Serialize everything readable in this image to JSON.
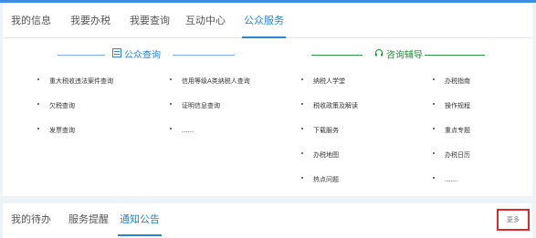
{
  "top_tabs": [
    {
      "label": "我的信息"
    },
    {
      "label": "我要办税"
    },
    {
      "label": "我要查询"
    },
    {
      "label": "互动中心"
    },
    {
      "label": "公众服务"
    }
  ],
  "public_query": {
    "title": "公众查询",
    "icon": "grid-icon",
    "color": "#2a84d6",
    "items": [
      "重大税收违法案件查询",
      "信用等级A类纳税人查询",
      "欠税查询",
      "证明信息查询",
      "发票查询",
      "......"
    ]
  },
  "consult": {
    "title": "咨询辅导",
    "icon": "headset-icon",
    "color": "#1f8f3a",
    "items": [
      "纳税人学堂",
      "办税指南",
      "税收政策及解读",
      "操作规程",
      "下载服务",
      "重点专题",
      "办税地图",
      "办税日历",
      "热点问题",
      "......"
    ]
  },
  "bottom_tabs": [
    {
      "label": "我的待办"
    },
    {
      "label": "服务提醒"
    },
    {
      "label": "通知公告"
    }
  ],
  "more_label": "更多",
  "colors": {
    "accent": "#2a84d6",
    "highlight_border": "#e0272d",
    "page_bg": "#eef3f8"
  }
}
